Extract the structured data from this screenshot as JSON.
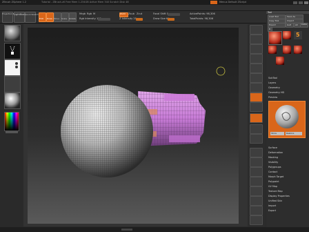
{
  "titlebar": {
    "app_title": "ZBrush   ZSphere 1.2",
    "center_text": "Tutorial - ZBrush.ztl  Free Mem 1.234GB  Active Mem 340  Scratch Disk 48",
    "right_text": "Menus   Default ZScript"
  },
  "menubar": {
    "items": [
      "Alpha",
      "Brush",
      "Color",
      "Document",
      "Draw",
      "Edit",
      "File",
      "Layer",
      "Light",
      "Macro",
      "Marker",
      "Material",
      "Movie",
      "Picture",
      "Preferences",
      "Render",
      "Stencil",
      "Stroke",
      "Texture",
      "Tool",
      "Transform",
      "Zplugin",
      "Zscript"
    ]
  },
  "toolbar": {
    "projection_master": "Projection Master",
    "lightbox": "LightBox",
    "quick_sketch": "Quick Sketch",
    "edit_label": "Edit",
    "draw_label": "Draw",
    "move_label": "Move",
    "scale_label": "Scale",
    "rotate_label": "Rotate",
    "mrgb": "Mrgb",
    "rgb": "Rgb",
    "m": "M",
    "zadd": "Zadd",
    "zsub": "Zsub",
    "zcut": "Zcut",
    "rgb_intensity": "Rgb Intensity 100",
    "z_intensity": "Z Intensity 25",
    "focal_shift": "Focal Shift 0",
    "draw_size": "Draw Size 64",
    "active_points": "ActivePoints: 98,306",
    "total_points": "TotalPoints: 98,306"
  },
  "tray": {
    "header": "Tool",
    "load_tool": "Load Tool",
    "save_as": "Save As",
    "copy_tool": "Copy Tool",
    "import": "Import",
    "export": "Export",
    "goz": "GoZ",
    "all": "All",
    "visible": "Visible",
    "r": "R",
    "tool_count": "5",
    "subtool": "SubTool",
    "layers": "Layers",
    "geometry": "Geometry",
    "geometry_hd": "Geometry HD",
    "preview": "Preview",
    "surface": "Surface",
    "deformation": "Deformation",
    "masking": "Masking",
    "visibility": "Visibility",
    "polygroups": "Polygroups",
    "contact": "Contact",
    "morph_target": "Morph Target",
    "polypaint": "Polypaint",
    "uv_map": "UV Map",
    "texture_map": "Texture Map",
    "display_properties": "Display Properties",
    "unified_skin": "Unified Skin",
    "import2": "Import",
    "export2": "Export",
    "store": "Store",
    "restore": "Restore"
  },
  "colors": {
    "accent": "#d9661a",
    "background": "#2b2b2b",
    "mesh_magenta": "#c77bd6"
  }
}
